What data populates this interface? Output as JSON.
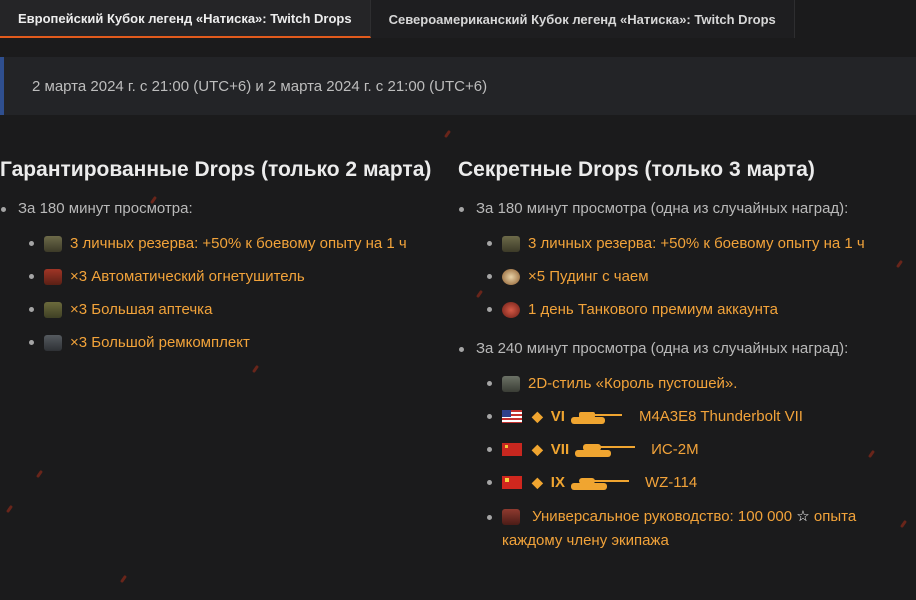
{
  "tabs": [
    {
      "label": "Европейский Кубок легенд «Натиска»: Twitch Drops",
      "active": true
    },
    {
      "label": "Североамериканский Кубок легенд «Натиска»: Twitch Drops",
      "active": false
    }
  ],
  "date_text": "2 марта 2024 г. с 21:00 (UTC+6) и 2 марта 2024 г. с 21:00 (UTC+6)",
  "guaranteed": {
    "title": "Гарантированные Drops (только 2 марта)",
    "section_title": "За 180 минут просмотра:",
    "items": [
      {
        "icon": "reserve-icon",
        "text": "3 личных резерва: +50% к боевому опыту на 1 ч"
      },
      {
        "icon": "fire-extinguisher-icon",
        "text": "×3 Автоматический огнетушитель"
      },
      {
        "icon": "medkit-icon",
        "text": "×3 Большая аптечка"
      },
      {
        "icon": "repair-kit-icon",
        "text": "×3 Большой ремкомплект"
      }
    ]
  },
  "secret": {
    "title": "Секретные Drops (только 3 марта)",
    "section1_title": "За 180 минут просмотра (одна из случайных наград):",
    "section1_items": [
      {
        "icon": "reserve-icon",
        "text": "3 личных резерва: +50% к боевому опыту на 1 ч"
      },
      {
        "icon": "pudding-icon",
        "text": "×5 Пудинг с чаем"
      },
      {
        "icon": "premium-icon",
        "text": "1 день Танкового премиум аккаунта"
      }
    ],
    "section2_title": "За 240 минут просмотра (одна из случайных наград):",
    "style_item": {
      "icon": "style-icon",
      "text": "2D-стиль «Король пустошей»."
    },
    "tanks": [
      {
        "flag": "usa-flag-icon",
        "tier": "VI",
        "name": "M4A3E8 Thunderbolt VII"
      },
      {
        "flag": "ussr-flag-icon",
        "tier": "VII",
        "name": "ИС-2М"
      },
      {
        "flag": "china-flag-icon",
        "tier": "IX",
        "name": "WZ-114"
      }
    ],
    "manual_item": {
      "icon": "manual-icon",
      "text_before_star": "Универсальное руководство: 100 000",
      "star": "☆",
      "text_after_star": " опыта",
      "text_line2": "каждому члену экипажа"
    }
  },
  "colors": {
    "accent_orange": "#f2a33a",
    "tab_underline": "#e25b1d",
    "date_bar_border": "#2f4f8f"
  }
}
